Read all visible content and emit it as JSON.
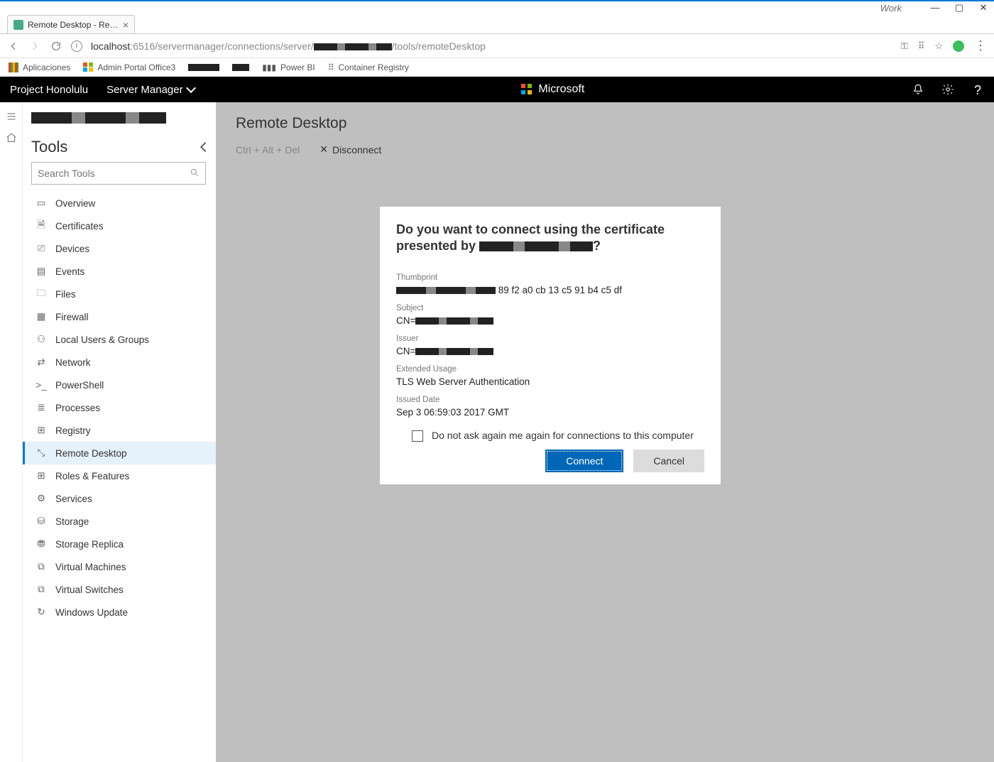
{
  "window": {
    "label": "Work"
  },
  "browser": {
    "tab_title": "Remote Desktop - Remo",
    "url_prefix": "localhost",
    "url_mid": ":6516/servermanager/connections/server/",
    "url_suffix": "/tools/remoteDesktop"
  },
  "bookmarks": {
    "apps": "Aplicaciones",
    "admin": "Admin Portal Office3",
    "powerbi": "Power BI",
    "container": "Container Registry"
  },
  "header": {
    "product": "Project Honolulu",
    "module": "Server Manager",
    "brand": "Microsoft"
  },
  "sidebar": {
    "tools_title": "Tools",
    "search_placeholder": "Search Tools",
    "items": [
      {
        "label": "Overview"
      },
      {
        "label": "Certificates"
      },
      {
        "label": "Devices"
      },
      {
        "label": "Events"
      },
      {
        "label": "Files"
      },
      {
        "label": "Firewall"
      },
      {
        "label": "Local Users & Groups"
      },
      {
        "label": "Network"
      },
      {
        "label": "PowerShell"
      },
      {
        "label": "Processes"
      },
      {
        "label": "Registry"
      },
      {
        "label": "Remote Desktop"
      },
      {
        "label": "Roles & Features"
      },
      {
        "label": "Services"
      },
      {
        "label": "Storage"
      },
      {
        "label": "Storage Replica"
      },
      {
        "label": "Virtual Machines"
      },
      {
        "label": "Virtual Switches"
      },
      {
        "label": "Windows Update"
      }
    ]
  },
  "page": {
    "title": "Remote Desktop",
    "ctrl_alt_del": "Ctrl + Alt + Del",
    "disconnect": "Disconnect"
  },
  "dialog": {
    "heading_1": "Do you want to connect using the certificate presented by ",
    "heading_2": "?",
    "thumbprint_label": "Thumbprint",
    "thumbprint_val_suffix": " 89 f2 a0 cb 13 c5 91 b4 c5 df",
    "subject_label": "Subject",
    "subject_prefix": "CN=",
    "issuer_label": "Issuer",
    "issuer_prefix": "CN=",
    "ext_usage_label": "Extended Usage",
    "ext_usage_val": "TLS Web Server Authentication",
    "issued_label": "Issued Date",
    "issued_val": "Sep 3 06:59:03 2017 GMT",
    "checkbox": "Do not ask again me again for connections to this computer",
    "connect": "Connect",
    "cancel": "Cancel"
  }
}
